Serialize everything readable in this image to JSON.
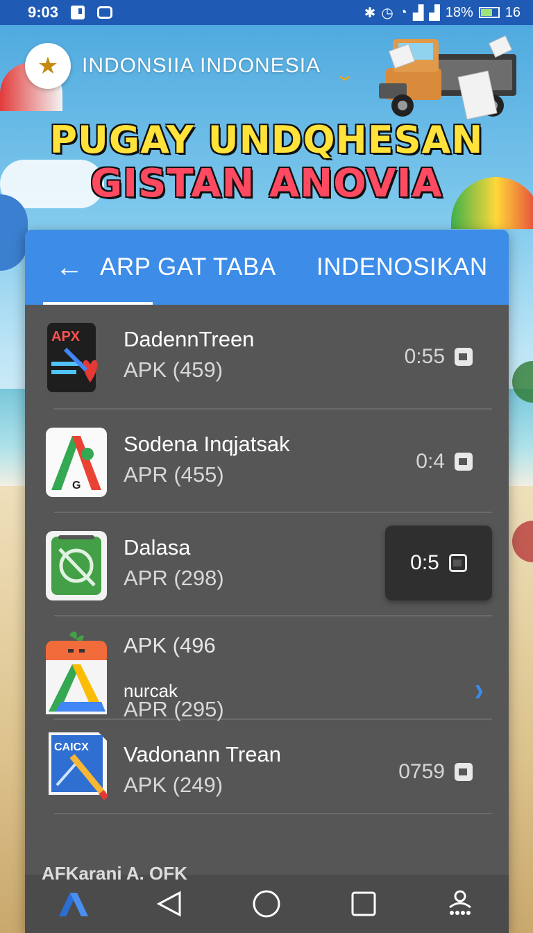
{
  "status_bar": {
    "time": "9:03",
    "battery": "18%",
    "extra": "16"
  },
  "header": {
    "brand_name": "INDONSIIA INDONESIA",
    "headline_line1": "PUGAY UNDQHESAN",
    "headline_line2": "GISTAN ANOVIA"
  },
  "tabs": [
    {
      "label": "ARP GAT TABA"
    },
    {
      "label": "INDENOSIKAN"
    }
  ],
  "apps": [
    {
      "name": "DadennTreen",
      "sub": "APK (459)",
      "time": "0:55",
      "icon_text": "APX"
    },
    {
      "name": "Sodena Inqjatsak",
      "sub": "APR (455)",
      "time": "0:4",
      "icon_text": "G"
    },
    {
      "name": "Dalasa",
      "sub": "APR (298)",
      "time": "0:5"
    },
    {
      "name": "nurcak",
      "line1": "APK (496",
      "sub": "APR (295)"
    },
    {
      "name": "Vadonann Trean",
      "sub": "APK (249)",
      "time": "0759",
      "icon_text": "CAICX"
    }
  ],
  "partial_row": "AFKarani  A. OFK",
  "colors": {
    "status_bar": "#1f5bb5",
    "tab_bar": "#3d8ce8",
    "panel": "#565656",
    "headline_yellow": "#ffe33a",
    "headline_red": "#ff4a62"
  }
}
